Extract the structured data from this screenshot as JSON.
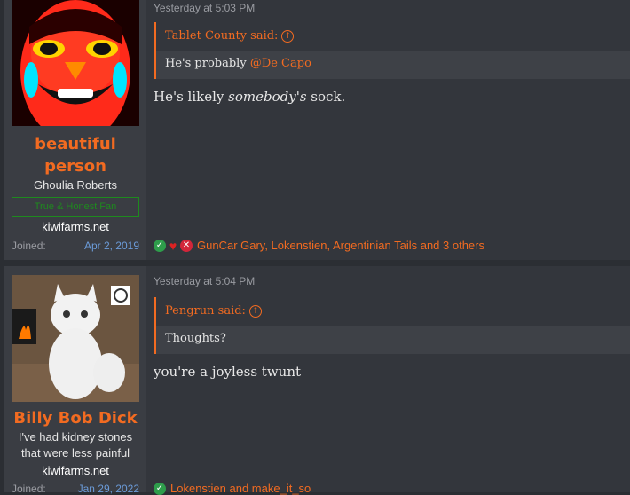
{
  "posts": [
    {
      "username": "beautiful person",
      "username_line1": "beautiful",
      "username_line2": "person",
      "user_title": "Ghoulia Roberts",
      "banner": "True & Honest Fan",
      "site": "kiwifarms.net",
      "joined_label": "Joined:",
      "joined_date": "Apr 2, 2019",
      "timestamp": "Yesterday at 5:03 PM",
      "quote_author": "Tablet County said:",
      "quote_text": "He's probably ",
      "quote_mention": "@De Capo",
      "body_pre": "He's likely ",
      "body_em": "somebody's",
      "body_post": " sock.",
      "reactions": [
        "check-reaction",
        "heart-reaction",
        "x-reaction"
      ],
      "reaction_users": "GunCar Gary, Lokenstien, Argentinian Tails and 3 others"
    },
    {
      "username": "Billy Bob Dick",
      "user_title_line1": "I've had kidney stones",
      "user_title_line2": "that were less painful",
      "site": "kiwifarms.net",
      "joined_label": "Joined:",
      "joined_date": "Jan 29, 2022",
      "timestamp": "Yesterday at 5:04 PM",
      "quote_author": "Pengrun said:",
      "quote_text": "Thoughts?",
      "body": "you're a joyless twunt",
      "reactions": [
        "check-reaction"
      ],
      "reaction_users": "Lokenstien and make_it_so"
    }
  ],
  "colors": {
    "accent": "#f26b21",
    "link": "#6b9bd8",
    "background": "#33363c",
    "sidebar": "#3a3d43"
  }
}
